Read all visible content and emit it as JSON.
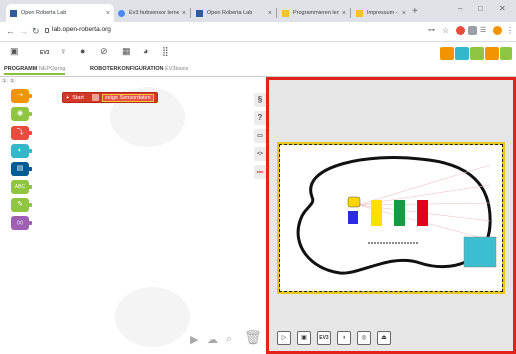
{
  "browser": {
    "tabs": [
      {
        "title": "Open Roberta Lab",
        "favicon_color": "#2f5d9b",
        "active": true
      },
      {
        "title": "Ev3 farbsensor lernen mit F...",
        "favicon_color": "#4b8bf5",
        "active": false
      },
      {
        "title": "Open Roberta Lab",
        "favicon_color": "#2f5d9b",
        "active": false
      },
      {
        "title": "Programmieren lernen mit R...",
        "favicon_color": "#f2c12e",
        "active": false
      },
      {
        "title": "Impressum - Roberta",
        "favicon_color": "#f2c12e",
        "active": false
      }
    ],
    "new_tab_symbol": "+",
    "url": "lab.open-roberta.org",
    "window_controls": [
      "–",
      "□",
      "✕"
    ]
  },
  "toolbar": {
    "robot_label": "EV3"
  },
  "mode_tabs": {
    "program": {
      "label": "PROGRAMM",
      "name": "NEPOprog"
    },
    "config": {
      "label": "ROBOTERKONFIGURATION",
      "name": "EV3basis"
    }
  },
  "workspace": {
    "level_buttons": [
      "1",
      "2"
    ],
    "start_block": {
      "label": "Start",
      "sensor_label": "zeige Sensordaten"
    },
    "side_tools": [
      "§",
      "?",
      "▭",
      "<>",
      "sim"
    ]
  },
  "categories": [
    {
      "icon": "action-icon",
      "glyph": "⇢",
      "color": "#f29400"
    },
    {
      "icon": "sensor-icon",
      "glyph": "◉",
      "color": "#8fc541"
    },
    {
      "icon": "control-icon",
      "glyph": "⤵",
      "color": "#e94b3c"
    },
    {
      "icon": "logic-icon",
      "glyph": "◐",
      "color": "#33b8ca"
    },
    {
      "icon": "math-icon",
      "glyph": "▤",
      "color": "#005a94"
    },
    {
      "icon": "text-icon",
      "glyph": "ABC",
      "color": "#8fc541"
    },
    {
      "icon": "color-icon",
      "glyph": "✎",
      "color": "#8fc541"
    },
    {
      "icon": "variable-icon",
      "glyph": "(x)",
      "color": "#9e5fb5"
    }
  ],
  "simulation": {
    "border_color": "#e2231a",
    "blocks": [
      {
        "color": "#ffe000"
      },
      {
        "color": "#1a9a3e"
      },
      {
        "color": "#e2001a"
      }
    ],
    "robot_colors": [
      "#2b2be0",
      "#ffd400"
    ],
    "cyan_box_color": "#3abed0",
    "bottom_buttons": [
      "play-icon",
      "image-icon",
      "ev3-icon",
      "sound-icon",
      "target-icon",
      "robot-icon"
    ],
    "ev3_button_label": "EV3"
  }
}
